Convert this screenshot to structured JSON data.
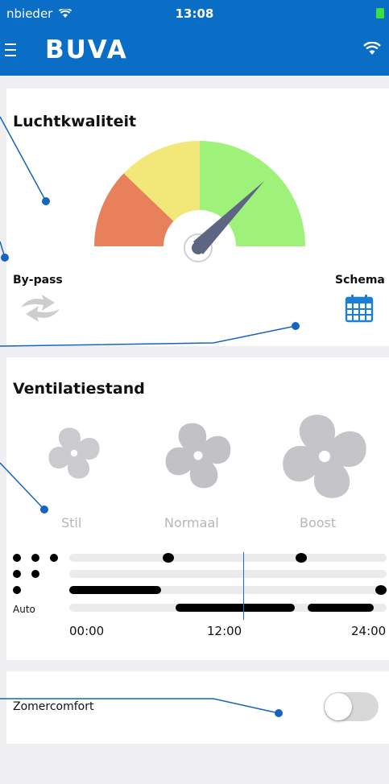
{
  "status_bar": {
    "carrier": "nbieder",
    "time": "13:08"
  },
  "app": {
    "logo": "BUVA"
  },
  "air_quality": {
    "title": "Luchtkwaliteit",
    "bypass_label": "By-pass",
    "schedule_label": "Schema",
    "gauge_colors": [
      "#e8805b",
      "#f2e87a",
      "#9ef27a"
    ]
  },
  "ventilation": {
    "title": "Ventilatiestand",
    "modes": [
      {
        "label": "Stil"
      },
      {
        "label": "Normaal"
      },
      {
        "label": "Boost"
      }
    ],
    "auto_label": "Auto",
    "time_labels": [
      "00:00",
      "12:00",
      "24:00"
    ]
  },
  "summer_comfort": {
    "label": "Zomercomfort",
    "enabled": false
  },
  "colors": {
    "brand_blue": "#0a6ec6",
    "annotation_blue": "#1565c0"
  },
  "icons": [
    "menu-icon",
    "wifi-icon",
    "bypass-icon",
    "calendar-icon",
    "fan-icon"
  ]
}
